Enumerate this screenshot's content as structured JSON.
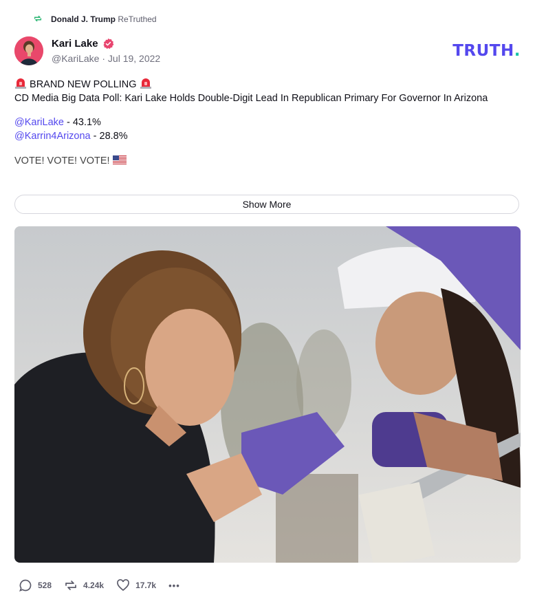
{
  "retruth": {
    "user": "Donald J. Trump",
    "label": "ReTruthed",
    "icon": "retruth-icon"
  },
  "author": {
    "display_name": "Kari Lake",
    "handle": "@KariLake",
    "separator": "·",
    "date": "Jul 19, 2022",
    "verified_icon": "verified-badge-icon"
  },
  "brand": {
    "logo_text": "TRUTH",
    "logo_dot": ".",
    "color": "#5448ee",
    "dot_color": "#18c5a6"
  },
  "post": {
    "headline": "BRAND NEW POLLING",
    "body": "CD Media Big Data Poll: Kari Lake Holds Double-Digit Lead In Republican Primary For Governor In Arizona",
    "poll": [
      {
        "mention": "@KariLake",
        "value": " - 43.1%"
      },
      {
        "mention": "@Karrin4Arizona",
        "value": " - 28.8%"
      }
    ],
    "cta": "VOTE! VOTE! VOTE!"
  },
  "show_more_label": "Show More",
  "actions": {
    "replies": "528",
    "retruths": "4.24k",
    "likes": "17.7k",
    "more": "•••"
  }
}
